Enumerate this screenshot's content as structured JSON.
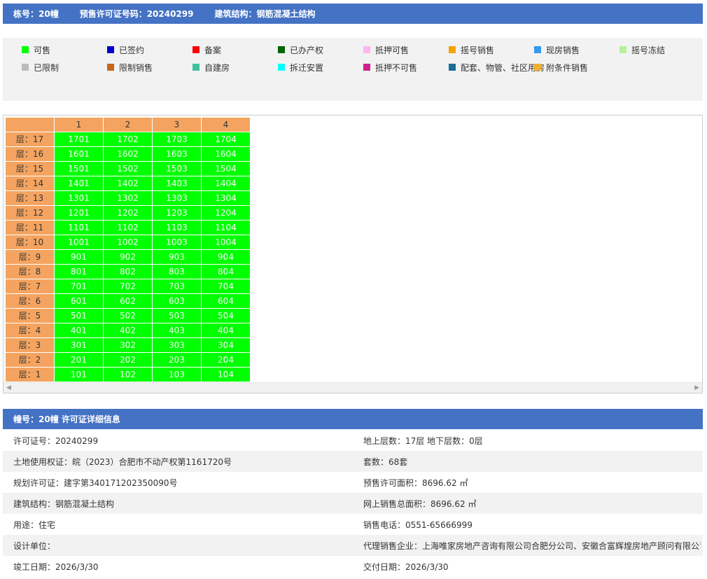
{
  "header": {
    "building": "栋号：20幢",
    "permit": "预售许可证号码：20240299",
    "structure": "建筑结构：钢筋混凝土结构"
  },
  "legend": [
    {
      "label": "可售",
      "color": "#00ff00"
    },
    {
      "label": "已签约",
      "color": "#0000cc"
    },
    {
      "label": "备案",
      "color": "#ff0000"
    },
    {
      "label": "已办产权",
      "color": "#006400"
    },
    {
      "label": "抵押可售",
      "color": "#ffb6f0"
    },
    {
      "label": "摇号销售",
      "color": "#f5a300"
    },
    {
      "label": "现房销售",
      "color": "#3399ee"
    },
    {
      "label": "摇号冻结",
      "color": "#b7f09a"
    },
    {
      "label": "已限制",
      "color": "#bbbbbb"
    },
    {
      "label": "限制销售",
      "color": "#c8671a"
    },
    {
      "label": "自建房",
      "color": "#3fc0a0"
    },
    {
      "label": "拆迁安置",
      "color": "#00ffff"
    },
    {
      "label": "抵押不可售",
      "color": "#d0208c"
    },
    {
      "label": "配套、物管、社区用房",
      "color": "#1a6e99"
    },
    {
      "label": "附条件销售",
      "color": "#f0b030"
    }
  ],
  "grid": {
    "columns": [
      "1",
      "2",
      "3",
      "4"
    ],
    "floor_prefix": "层：",
    "floors": [
      {
        "floor": "17",
        "units": [
          "1701",
          "1702",
          "1703",
          "1704"
        ]
      },
      {
        "floor": "16",
        "units": [
          "1601",
          "1602",
          "1603",
          "1604"
        ]
      },
      {
        "floor": "15",
        "units": [
          "1501",
          "1502",
          "1503",
          "1504"
        ]
      },
      {
        "floor": "14",
        "units": [
          "1401",
          "1402",
          "1403",
          "1404"
        ]
      },
      {
        "floor": "13",
        "units": [
          "1301",
          "1302",
          "1303",
          "1304"
        ]
      },
      {
        "floor": "12",
        "units": [
          "1201",
          "1202",
          "1203",
          "1204"
        ]
      },
      {
        "floor": "11",
        "units": [
          "1101",
          "1102",
          "1103",
          "1104"
        ]
      },
      {
        "floor": "10",
        "units": [
          "1001",
          "1002",
          "1003",
          "1004"
        ]
      },
      {
        "floor": "9",
        "units": [
          "901",
          "902",
          "903",
          "904"
        ]
      },
      {
        "floor": "8",
        "units": [
          "801",
          "802",
          "803",
          "804"
        ]
      },
      {
        "floor": "7",
        "units": [
          "701",
          "702",
          "703",
          "704"
        ]
      },
      {
        "floor": "6",
        "units": [
          "601",
          "602",
          "603",
          "604"
        ]
      },
      {
        "floor": "5",
        "units": [
          "501",
          "502",
          "503",
          "504"
        ]
      },
      {
        "floor": "4",
        "units": [
          "401",
          "402",
          "403",
          "404"
        ]
      },
      {
        "floor": "3",
        "units": [
          "301",
          "302",
          "303",
          "304"
        ]
      },
      {
        "floor": "2",
        "units": [
          "201",
          "202",
          "203",
          "204"
        ]
      },
      {
        "floor": "1",
        "units": [
          "101",
          "102",
          "103",
          "104"
        ]
      }
    ],
    "unit_status_color": "#00ff00",
    "scroll_left_icon": "◀",
    "scroll_right_icon": "▶"
  },
  "details": {
    "title": "幢号：20幢 许可证详细信息",
    "rows": [
      {
        "left": "许可证号：20240299",
        "right": "地上层数：17层  地下层数：0层"
      },
      {
        "left": "土地使用权证：皖（2023）合肥市不动产权第1161720号",
        "right": "套数：68套"
      },
      {
        "left": "规划许可证：建字第340171202350090号",
        "right": "预售许可面积：8696.62 ㎡"
      },
      {
        "left": "建筑结构：钢筋混凝土结构",
        "right": "网上销售总面积：8696.62 ㎡"
      },
      {
        "left": "用途：住宅",
        "right": "销售电话：0551-65666999"
      },
      {
        "left": "设计单位：",
        "right": "代理销售企业：上海唯家房地产咨询有限公司合肥分公司、安徽合富辉煌房地产顾问有限公司"
      },
      {
        "left": "竣工日期：2026/3/30",
        "right": "交付日期：2026/3/30"
      }
    ]
  }
}
